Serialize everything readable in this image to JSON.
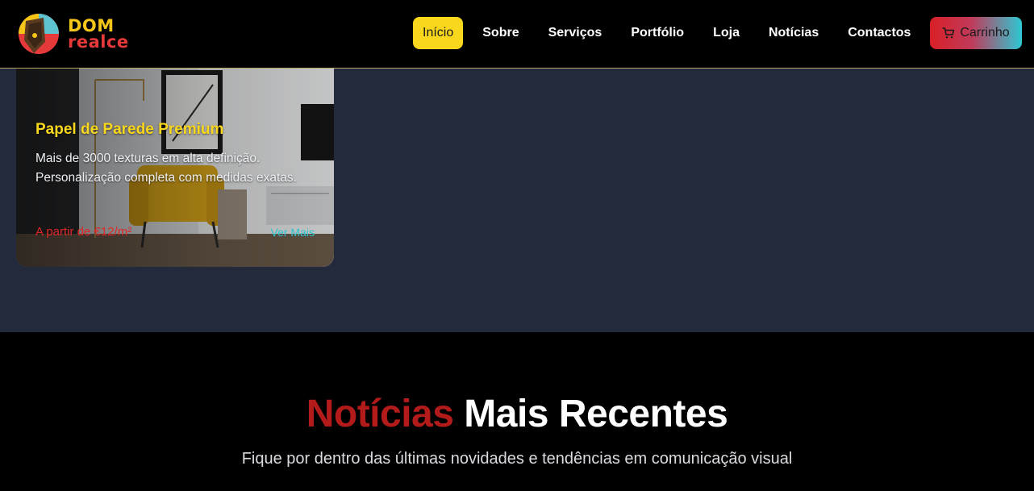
{
  "header": {
    "logo": {
      "line1": "DOM",
      "line2": "realce"
    },
    "nav": [
      {
        "label": "Início",
        "active": true
      },
      {
        "label": "Sobre",
        "active": false
      },
      {
        "label": "Serviços",
        "active": false
      },
      {
        "label": "Portfólio",
        "active": false
      },
      {
        "label": "Loja",
        "active": false
      },
      {
        "label": "Notícias",
        "active": false
      },
      {
        "label": "Contactos",
        "active": false
      }
    ],
    "cart": {
      "label": "Carrinho",
      "icon": "cart-icon"
    }
  },
  "card": {
    "title": "Papel de Parede Premium",
    "description": "Mais de 3000 texturas em alta definição. Personalização completa com medidas exatas.",
    "price": "A partir de €12/m²",
    "more": "Ver Mais"
  },
  "news": {
    "title_accent": "Notícias",
    "title_rest": "Mais Recentes",
    "subtitle": "Fique por dentro das últimas novidades e tendências em comunicação visual"
  },
  "colors": {
    "accent_yellow": "#f9d71c",
    "accent_red": "#e02727",
    "accent_teal": "#2bc6cf",
    "band_bg": "#222a3b"
  }
}
